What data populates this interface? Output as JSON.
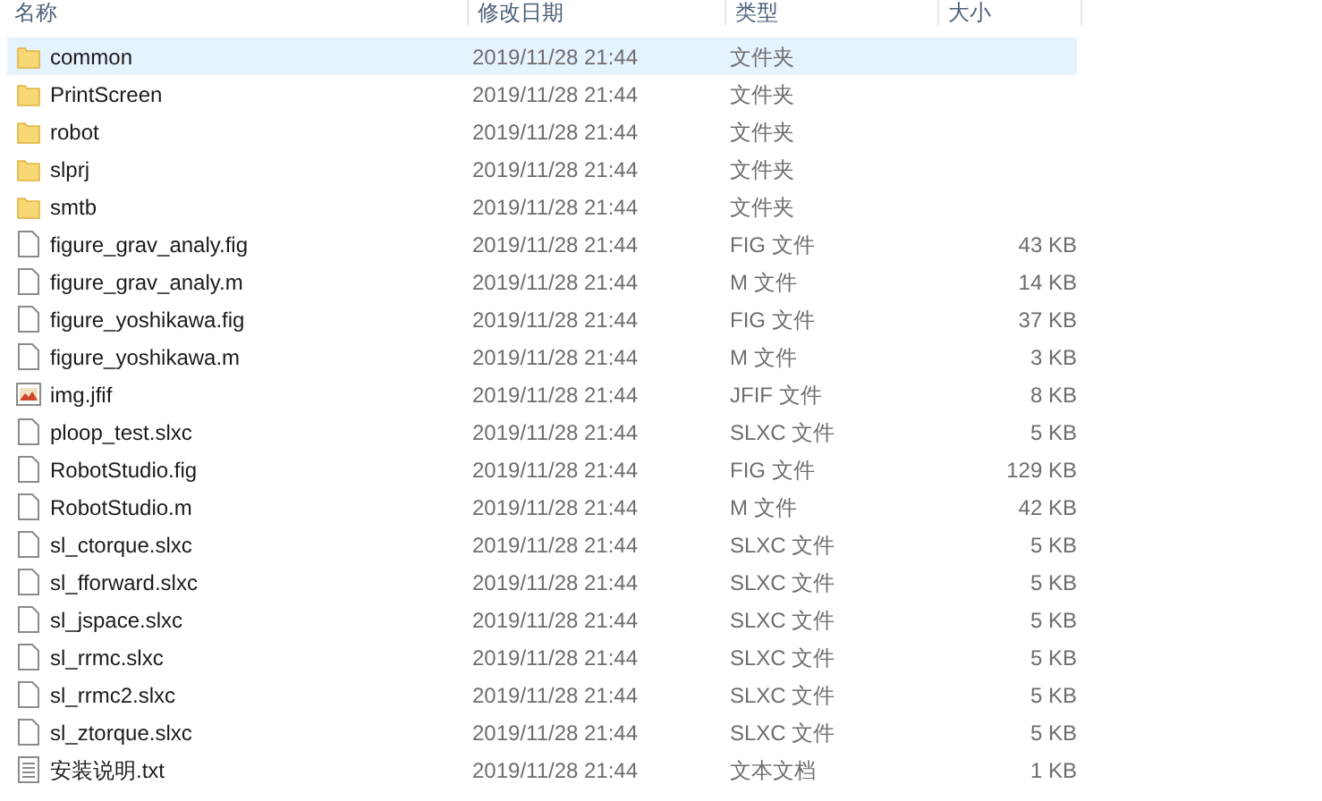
{
  "columns": [
    "名称",
    "修改日期",
    "类型",
    "大小"
  ],
  "rows": [
    {
      "kind": "folder",
      "name": "common",
      "date": "2019/11/28 21:44",
      "type": "文件夹",
      "selected": true
    },
    {
      "kind": "folder",
      "name": "PrintScreen",
      "date": "2019/11/28 21:44",
      "type": "文件夹",
      "selected": false
    },
    {
      "kind": "folder",
      "name": "robot",
      "date": "2019/11/28 21:44",
      "type": "文件夹",
      "selected": false
    },
    {
      "kind": "folder",
      "name": "slprj",
      "date": "2019/11/28 21:44",
      "type": "文件夹",
      "selected": false
    },
    {
      "kind": "folder",
      "name": "smtb",
      "date": "2019/11/28 21:44",
      "type": "文件夹",
      "selected": false
    },
    {
      "kind": "file",
      "name": "figure_grav_analy.fig",
      "date": "2019/11/28 21:44",
      "type": "FIG 文件",
      "size": "43 KB",
      "selected": false
    },
    {
      "kind": "file",
      "name": "figure_grav_analy.m",
      "date": "2019/11/28 21:44",
      "type": "M 文件",
      "size": "14 KB",
      "selected": false
    },
    {
      "kind": "file",
      "name": "figure_yoshikawa.fig",
      "date": "2019/11/28 21:44",
      "type": "FIG 文件",
      "size": "37 KB",
      "selected": false
    },
    {
      "kind": "file",
      "name": "figure_yoshikawa.m",
      "date": "2019/11/28 21:44",
      "type": "M 文件",
      "size": "3 KB",
      "selected": false
    },
    {
      "kind": "image",
      "name": "img.jfif",
      "date": "2019/11/28 21:44",
      "type": "JFIF 文件",
      "size": "8 KB",
      "selected": false
    },
    {
      "kind": "file",
      "name": "ploop_test.slxc",
      "date": "2019/11/28 21:44",
      "type": "SLXC 文件",
      "size": "5 KB",
      "selected": false
    },
    {
      "kind": "file",
      "name": "RobotStudio.fig",
      "date": "2019/11/28 21:44",
      "type": "FIG 文件",
      "size": "129 KB",
      "selected": false
    },
    {
      "kind": "file",
      "name": "RobotStudio.m",
      "date": "2019/11/28 21:44",
      "type": "M 文件",
      "size": "42 KB",
      "selected": false
    },
    {
      "kind": "file",
      "name": "sl_ctorque.slxc",
      "date": "2019/11/28 21:44",
      "type": "SLXC 文件",
      "size": "5 KB",
      "selected": false
    },
    {
      "kind": "file",
      "name": "sl_fforward.slxc",
      "date": "2019/11/28 21:44",
      "type": "SLXC 文件",
      "size": "5 KB",
      "selected": false
    },
    {
      "kind": "file",
      "name": "sl_jspace.slxc",
      "date": "2019/11/28 21:44",
      "type": "SLXC 文件",
      "size": "5 KB",
      "selected": false
    },
    {
      "kind": "file",
      "name": "sl_rrmc.slxc",
      "date": "2019/11/28 21:44",
      "type": "SLXC 文件",
      "size": "5 KB",
      "selected": false
    },
    {
      "kind": "file",
      "name": "sl_rrmc2.slxc",
      "date": "2019/11/28 21:44",
      "type": "SLXC 文件",
      "size": "5 KB",
      "selected": false
    },
    {
      "kind": "file",
      "name": "sl_ztorque.slxc",
      "date": "2019/11/28 21:44",
      "type": "SLXC 文件",
      "size": "5 KB",
      "selected": false
    },
    {
      "kind": "text",
      "name": "安装说明.txt",
      "date": "2019/11/28 21:44",
      "type": "文本文档",
      "size": "1 KB",
      "selected": false
    }
  ]
}
